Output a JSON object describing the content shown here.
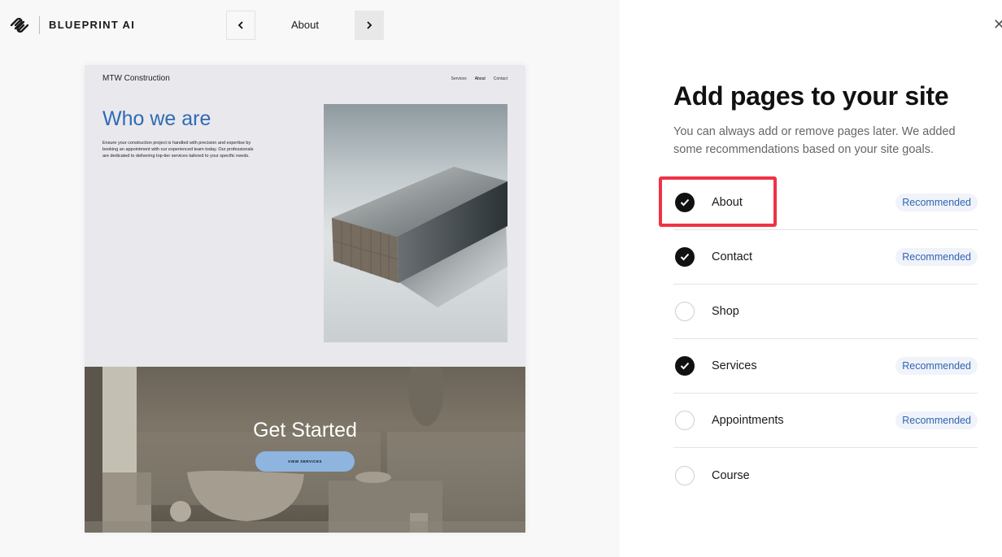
{
  "header": {
    "brand": "BLUEPRINT AI",
    "logo_icon": "squarespace-logo-icon",
    "prev_icon": "chevron-left-icon",
    "next_icon": "chevron-right-icon",
    "current_page": "About"
  },
  "preview": {
    "site_name": "MTW Construction",
    "nav": [
      "Services",
      "About",
      "Contact"
    ],
    "active_nav": "About",
    "hero_title": "Who we are",
    "hero_text": "Ensure your construction project is handled with precision and expertise by booking an appointment with our experienced team today. Our professionals are dedicated to delivering top-tier services tailored to your specific needs.",
    "hero_image": "stacked-wood-planks-image",
    "cta_image": "bathroom-interior-image",
    "cta_title": "Get Started",
    "cta_button": "VIEW SERVICES"
  },
  "panel": {
    "close_icon": "close-icon",
    "title": "Add pages to your site",
    "description": "You can always add or remove pages later. We added some recommendations based on your site goals.",
    "badge_label": "Recommended",
    "pages": [
      {
        "label": "About",
        "checked": true,
        "recommended": true,
        "highlighted": true
      },
      {
        "label": "Contact",
        "checked": true,
        "recommended": true
      },
      {
        "label": "Shop",
        "checked": false,
        "recommended": false
      },
      {
        "label": "Services",
        "checked": true,
        "recommended": true
      },
      {
        "label": "Appointments",
        "checked": false,
        "recommended": true
      },
      {
        "label": "Course",
        "checked": false,
        "recommended": false
      }
    ]
  },
  "colors": {
    "accent_blue": "#2e6bb5",
    "badge_text": "#2e65b0",
    "badge_bg": "#f1f3fb",
    "highlight_red": "#ef3344",
    "cta_button": "#8db5e0"
  }
}
